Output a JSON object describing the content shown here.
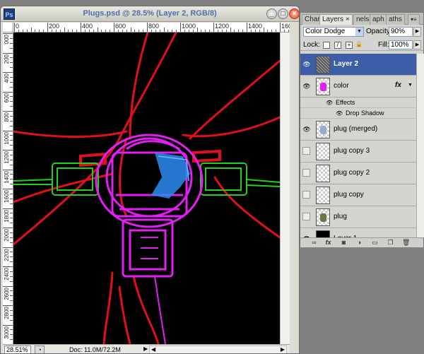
{
  "document": {
    "app_icon": "Ps",
    "title": "Plugs.psd @ 28.5% (Layer 2, RGB/8)",
    "ruler_h_labels": [
      "0",
      "200",
      "400",
      "600",
      "800",
      "1000",
      "1200",
      "1400",
      "1600"
    ],
    "ruler_v_labels": [
      "0",
      "2",
      "4",
      "6",
      "8",
      "10",
      "12",
      "14",
      "16",
      "18",
      "20",
      "22",
      "24",
      "26",
      "28",
      "30"
    ],
    "zoom": "28.51%",
    "doc_info": "Doc: 11.0M/72.2M"
  },
  "panel": {
    "tabs": [
      {
        "label": "Char",
        "active": false
      },
      {
        "label": "Layers ×",
        "active": true
      },
      {
        "label": "nels",
        "active": false
      },
      {
        "label": "aph",
        "active": false
      },
      {
        "label": "aths",
        "active": false
      }
    ],
    "blend_mode": "Color Dodge",
    "opacity_label": "Opacity:",
    "opacity_value": "90%",
    "lock_label": "Lock:",
    "fill_label": "Fill:",
    "fill_value": "100%",
    "layers": [
      {
        "name": "Layer 2",
        "visible": true,
        "selected": true,
        "thumb": "noise"
      },
      {
        "name": "color",
        "visible": true,
        "selected": false,
        "thumb": "color",
        "fx": "fx"
      },
      {
        "name": "plug (merged)",
        "visible": true,
        "selected": false,
        "thumb": "merged"
      },
      {
        "name": "plug copy 3",
        "visible": false,
        "selected": false,
        "thumb": "empty"
      },
      {
        "name": "plug copy 2",
        "visible": false,
        "selected": false,
        "thumb": "empty"
      },
      {
        "name": "plug copy",
        "visible": false,
        "selected": false,
        "thumb": "empty"
      },
      {
        "name": "plug",
        "visible": false,
        "selected": false,
        "thumb": "plug"
      },
      {
        "name": "Layer 1",
        "visible": true,
        "selected": false,
        "thumb": "black"
      }
    ],
    "effects_label": "Effects",
    "effect_item": "Drop Shadow"
  },
  "colors": {
    "selection": "#3d5da7",
    "canvas_bg": "#000000",
    "wire_red": "#e0101a",
    "plug_magenta": "#e020f0",
    "plug_green": "#20d020",
    "plug_blue": "#2a8cf0"
  }
}
